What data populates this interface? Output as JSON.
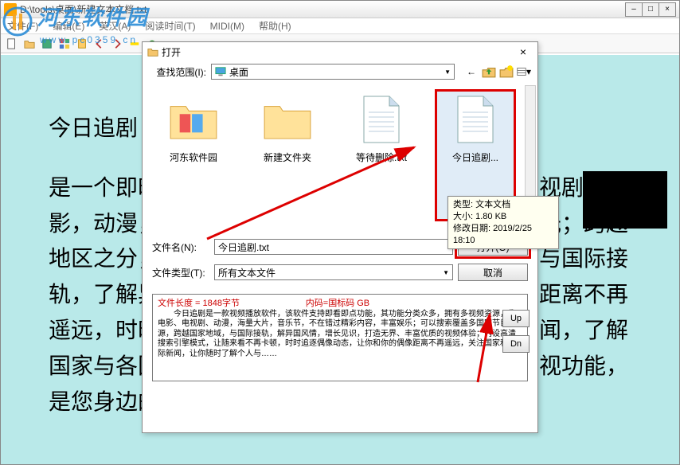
{
  "window": {
    "title": "D:\\tools\\桌面\\新建文本文档.txt"
  },
  "menu": {
    "items": [
      "文件(F)",
      "编辑(E)",
      "英汉(A)",
      "阅读时间(T)",
      "MIDI(M)",
      "帮助(H)"
    ]
  },
  "content": {
    "title": "今日追剧",
    "body": "是一个即时更新海量高清影视的平台，不管是看电视剧，电影，动漫，综艺还是纪录片它都能够打发您的闲时光；跨越地区之分，多国模式，可能还带有翻译字幕，轻松与国际接轨，了解异国风情是您娱乐学习好模式，与明星的距离不再遥远，时时刻刻关注偶像动态，关注国事与国际新闻，了解国家与各国之间关系；还支持根据推荐喜好推荐影视功能，是您身边的全方位智能追剧神器。"
  },
  "dialog": {
    "title": "打开",
    "look_in_label": "查找范围(I):",
    "look_in_value": "桌面",
    "files": [
      {
        "label": "河东软件园",
        "type": "folder-photos"
      },
      {
        "label": "新建文件夹",
        "type": "folder"
      },
      {
        "label": "等待删除.txt",
        "type": "txt"
      },
      {
        "label": "今日追剧...",
        "type": "txt",
        "selected": true
      }
    ],
    "tooltip": {
      "type": "类型: 文本文档",
      "size": "大小: 1.80 KB",
      "modified": "修改日期: 2019/2/25 18:10"
    },
    "filename_label": "文件名(N):",
    "filename_value": "今日追剧.txt",
    "filetype_label": "文件类型(T):",
    "filetype_value": "所有文本文件",
    "open_btn": "打开(O)",
    "cancel_btn": "取消",
    "up_btn": "Up",
    "dn_btn": "Dn",
    "preview": {
      "length": "文件长度 = 1848字节",
      "encoding": "内码=国标码    GB",
      "body": "　　今日追剧是一款视频播放软件，该软件支持即看即点功能，其功能分类众多，拥有多视频资源，像电影、电视剧、动漫，海量大片，音乐节，不在错过精彩内容，丰富娱乐；可以搜索覆盖多国家节目资源，跨越国家地域，与国际接轨，解异国风情，增长见识，打造无界、丰富优质的视频体验；内设高清搜索引擎模式，让随来看不再卡顿，时时追逐偶像动态，让你和你的偶像距离不再遥远，关注国家和国际新闻，让你随时了解个人与……"
    }
  },
  "watermark": {
    "name": "河东软件园",
    "url": "www.pc0359.cn"
  }
}
